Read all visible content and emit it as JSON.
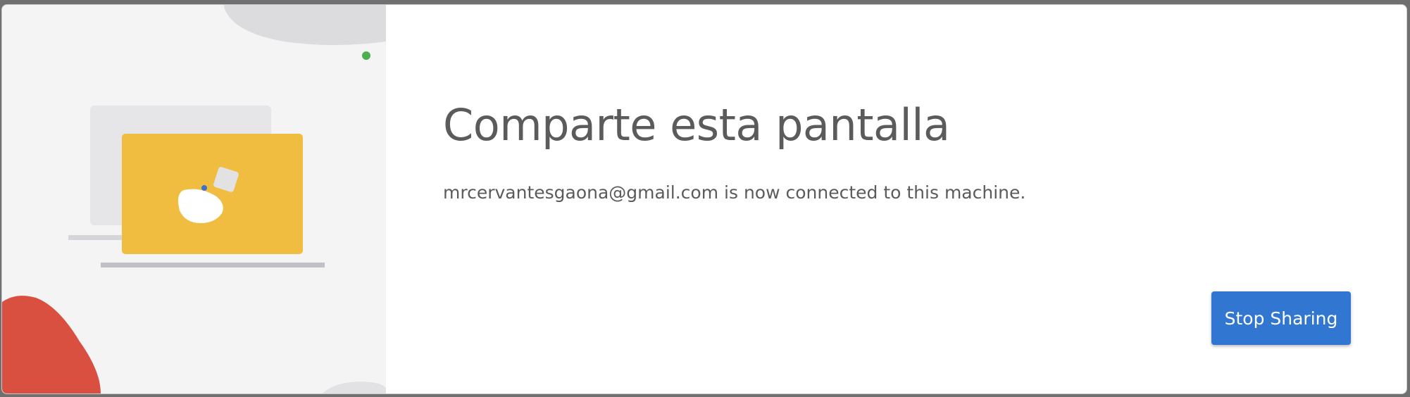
{
  "dialog": {
    "title": "Comparte esta pantalla",
    "message": "mrcervantesgaona@gmail.com is now connected to this machine.",
    "stop_button_label": "Stop Sharing"
  },
  "colors": {
    "accent": "#3176d0",
    "illustration_laptop": "#f1bd40",
    "illustration_blob_red": "#d95040",
    "status_dot": "#4caf50"
  },
  "icons": {
    "illustration": "screen-sharing-laptop-illustration",
    "status": "status-dot-icon"
  }
}
